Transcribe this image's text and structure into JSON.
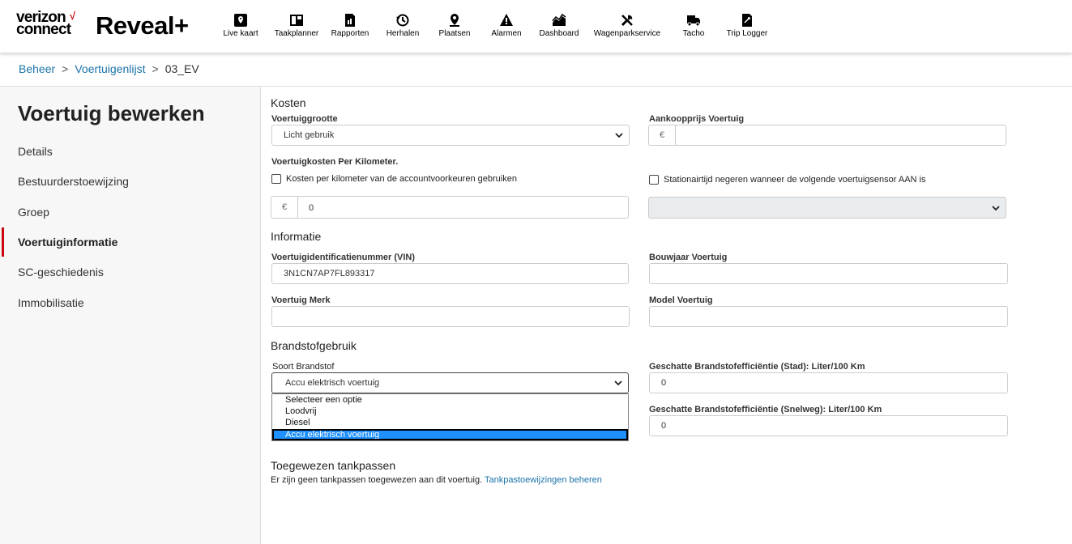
{
  "header": {
    "logo_line1": "verizon",
    "logo_line2": "connect",
    "logo_check": "√",
    "product": "Reveal+",
    "nav": [
      {
        "label": "Live kaart",
        "icon": "map-pin-icon"
      },
      {
        "label": "Taakplanner",
        "icon": "planner-icon"
      },
      {
        "label": "Rapporten",
        "icon": "report-icon"
      },
      {
        "label": "Herhalen",
        "icon": "replay-icon"
      },
      {
        "label": "Plaatsen",
        "icon": "location-icon"
      },
      {
        "label": "Alarmen",
        "icon": "alert-icon"
      },
      {
        "label": "Dashboard",
        "icon": "dashboard-icon"
      },
      {
        "label": "Wagenparkservice",
        "icon": "wrench-icon"
      },
      {
        "label": "Tacho",
        "icon": "truck-icon"
      },
      {
        "label": "Trip Logger",
        "icon": "trip-logger-icon"
      }
    ]
  },
  "breadcrumb": {
    "items": [
      "Beheer",
      "Voertuigenlijst"
    ],
    "current": "03_EV",
    "separator": ">"
  },
  "sidebar": {
    "title": "Voertuig bewerken",
    "items": [
      "Details",
      "Bestuurderstoewijzing",
      "Groep",
      "Voertuiginformatie",
      "SC-geschiedenis",
      "Immobilisatie"
    ],
    "active": "Voertuiginformatie",
    "accent": "#cd040b"
  },
  "costs": {
    "title": "Kosten",
    "size_label": "Voertuiggrootte",
    "size_value": "Licht gebruik",
    "price_label": "Aankoopprijs Voertuig",
    "currency": "€",
    "price_value": "",
    "per_km_label": "Voertuigkosten Per Kilometer.",
    "use_account_label": "Kosten per kilometer van de accountvoorkeuren gebruiken",
    "idle_label": "Stationairtijd negeren wanneer de volgende voertuigsensor AAN is",
    "per_km_value": "0",
    "sensor_value": ""
  },
  "info": {
    "title": "Informatie",
    "vin_label": "Voertuigidentificatienummer (VIN)",
    "vin_value": "3N1CN7AP7FL893317",
    "year_label": "Bouwjaar Voertuig",
    "year_value": "",
    "brand_label": "Voertuig Merk",
    "brand_value": "",
    "model_label": "Model Voertuig",
    "model_value": ""
  },
  "fuel": {
    "title": "Brandstofgebruik",
    "type_label": "Soort Brandstof",
    "type_value": "Accu elektrisch voertuig",
    "options": [
      "Selecteer een optie",
      "Loodvrij",
      "Diesel",
      "Accu elektrisch voertuig"
    ],
    "city_label": "Geschatte Brandstofefficiëntie (Stad):  Liter/100 Km",
    "city_value": "0",
    "highway_label": "Geschatte Brandstofefficiëntie (Snelweg):  Liter/100 Km",
    "highway_value": "0"
  },
  "cards": {
    "title": "Toegewezen tankpassen",
    "text": "Er zijn geen tankpassen toegewezen aan dit voertuig.",
    "link": "Tankpastoewijzingen beheren"
  },
  "colors": {
    "link": "#1a73a8",
    "selected_option": "#1e90ff"
  }
}
